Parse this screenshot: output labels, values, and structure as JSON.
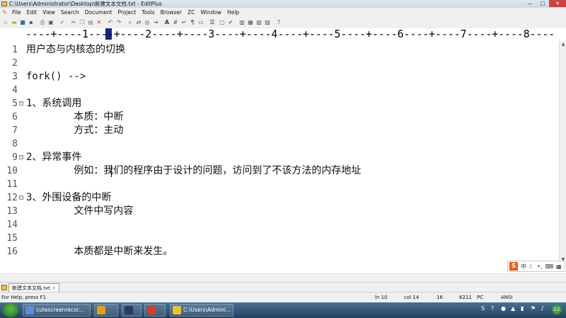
{
  "window": {
    "title": "C:\\Users\\Administrator\\Desktop\\新建文本文档.txt - EditPlus",
    "min_label": "—",
    "max_label": "□",
    "close_label": "✕"
  },
  "menu": [
    "File",
    "Edit",
    "View",
    "Search",
    "Document",
    "Project",
    "Tools",
    "Browser",
    "ZC",
    "Window",
    "Help"
  ],
  "ruler": "----+----1----+----2----+----3----+----4----+----5----+----6----+----7----+----8----",
  "lines": [
    {
      "num": "1",
      "text": "用户态与内核态的切换"
    },
    {
      "num": "2",
      "text": ""
    },
    {
      "num": "3",
      "text": "fork() -->"
    },
    {
      "num": "4",
      "text": ""
    },
    {
      "num": "5",
      "text": "1、系统调用"
    },
    {
      "num": "6",
      "text": "        本质：中断"
    },
    {
      "num": "7",
      "text": "        方式：主动"
    },
    {
      "num": "8",
      "text": ""
    },
    {
      "num": "9",
      "text": "2、异常事件"
    },
    {
      "num": "10",
      "text": "        例如：我们的程序由于设计的问题，访问到了不该方法的内存地址"
    },
    {
      "num": "11",
      "text": ""
    },
    {
      "num": "12",
      "text": "3、外围设备的中断"
    },
    {
      "num": "13",
      "text": "        文件中写内容"
    },
    {
      "num": "14",
      "text": ""
    },
    {
      "num": "15",
      "text": ""
    },
    {
      "num": "16",
      "text": "        本质都是中断来发生。"
    }
  ],
  "ime": {
    "logo": "S",
    "mode": "中"
  },
  "doc_tab": "新建文本文档.txt",
  "status": {
    "help": "For Help, press F1",
    "line": "ln 10",
    "col": "col 14",
    "count16": "16",
    "size": "6211",
    "mode": "PC",
    "encoding": "ANSI"
  },
  "taskbar": {
    "items": [
      {
        "label": "cutescreenrecor...",
        "color": "#5a8fd6"
      },
      {
        "label": "",
        "color": "#e0a020"
      },
      {
        "label": "",
        "color": "#2a3a6a"
      },
      {
        "label": "",
        "color": "#d0402a"
      },
      {
        "label": "C:\\Users\\Admini...",
        "color": "#e9c23c"
      }
    ],
    "tray_badge": "22"
  }
}
